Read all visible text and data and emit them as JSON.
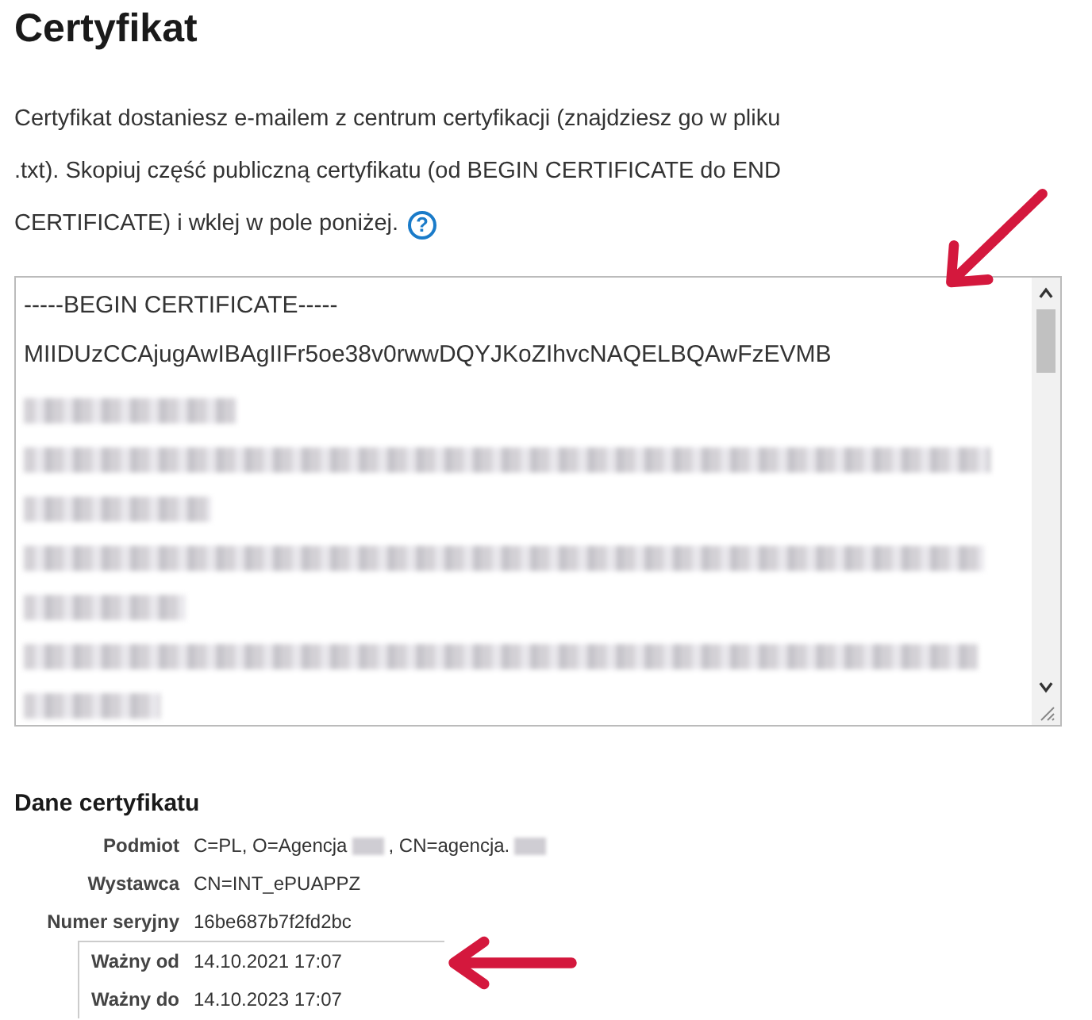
{
  "title": "Certyfikat",
  "instructions": [
    "Certyfikat dostaniesz e-mailem z centrum certyfikacji (znajdziesz go w pliku",
    ".txt). Skopiuj część publiczną certyfikatu (od BEGIN CERTIFICATE do END",
    "CERTIFICATE) i wklej w pole poniżej."
  ],
  "help_icon": "?",
  "certificate_field": {
    "lines": [
      {
        "kind": "text",
        "text": "-----BEGIN CERTIFICATE-----"
      },
      {
        "kind": "text",
        "text": "MIIDUzCCAjugAwIBAgIIFr5oe38v0rwwDQYJKoZIhvcNAQELBQAwFzEVMB"
      },
      {
        "kind": "redacted-short"
      },
      {
        "kind": "redacted-long"
      },
      {
        "kind": "redacted-short"
      },
      {
        "kind": "redacted-long"
      },
      {
        "kind": "redacted-short"
      },
      {
        "kind": "redacted-long"
      },
      {
        "kind": "redacted-short"
      }
    ]
  },
  "details": {
    "heading": "Dane certyfikatu",
    "rows": [
      {
        "label": "Podmiot",
        "parts": [
          {
            "kind": "text",
            "text": "C=PL, O=Agencja"
          },
          {
            "kind": "redacted"
          },
          {
            "kind": "text",
            "text": ", CN=agencja."
          },
          {
            "kind": "redacted"
          }
        ],
        "boxed": false
      },
      {
        "label": "Wystawca",
        "parts": [
          {
            "kind": "text",
            "text": "CN=INT_ePUAPPZ"
          }
        ],
        "boxed": false
      },
      {
        "label": "Numer seryjny",
        "parts": [
          {
            "kind": "text",
            "text": "16be687b7f2fd2bc"
          }
        ],
        "boxed": false
      },
      {
        "label": "Ważny od",
        "parts": [
          {
            "kind": "text",
            "text": "14.10.2021 17:07"
          }
        ],
        "boxed": true
      },
      {
        "label": "Ważny do",
        "parts": [
          {
            "kind": "text",
            "text": "14.10.2023 17:07"
          }
        ],
        "boxed": true
      }
    ]
  }
}
